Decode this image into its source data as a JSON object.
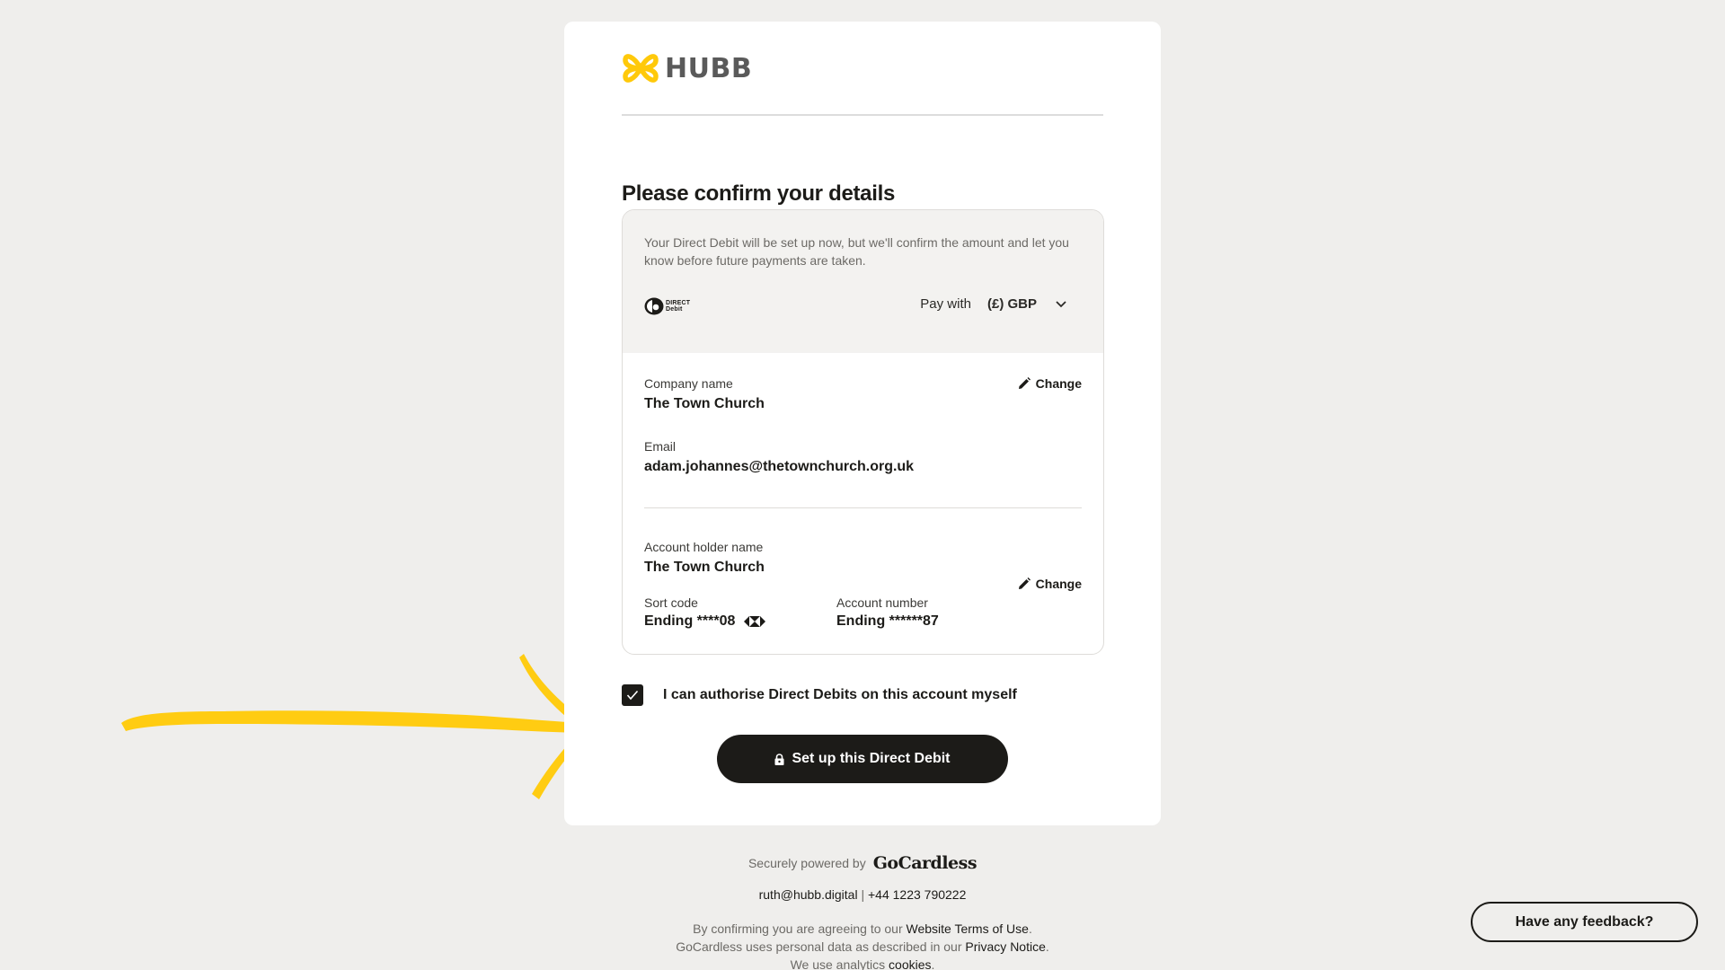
{
  "brand": {
    "name": "HUBB",
    "accent_color": "#ffc90a"
  },
  "page": {
    "title": "Please confirm your details"
  },
  "details": {
    "notice": "Your Direct Debit will be set up now, but we'll confirm the amount and let you know before future payments are taken.",
    "direct_debit_logo": {
      "line1": "DIRECT",
      "line2": "Debit"
    },
    "pay_with": {
      "label": "Pay with",
      "selected": "(£) GBP"
    },
    "company_name": {
      "label": "Company name",
      "value": "The Town Church"
    },
    "email": {
      "label": "Email",
      "value": "adam.johannes@thetownchurch.org.uk"
    },
    "account_holder_name": {
      "label": "Account holder name",
      "value": "The Town Church"
    },
    "sort_code": {
      "label": "Sort code",
      "value": "Ending ****08"
    },
    "account_number": {
      "label": "Account number",
      "value": "Ending ******87"
    },
    "change_label": "Change"
  },
  "authorise": {
    "checked": true,
    "label": "I can authorise Direct Debits on this account myself"
  },
  "submit": {
    "label": "Set up this Direct Debit"
  },
  "footer": {
    "powered_by": "Securely powered by",
    "provider": "GoCardless",
    "contact_email": "ruth@hubb.digital",
    "separator": "|",
    "contact_phone": "+44 1223 790222",
    "legal_line1_prefix": "By confirming you are agreeing to our ",
    "legal_line1_link": "Website Terms of Use",
    "legal_line1_suffix": ".",
    "legal_line2_prefix": "GoCardless uses personal data as described in our ",
    "legal_line2_link": "Privacy Notice",
    "legal_line2_suffix": ".",
    "legal_line3_prefix": "We use analytics ",
    "legal_line3_link": "cookies",
    "legal_line3_suffix": "."
  },
  "feedback": {
    "label": "Have any feedback?"
  },
  "annotation": {
    "type": "hand-drawn-arrow",
    "color": "#ffcc12"
  }
}
